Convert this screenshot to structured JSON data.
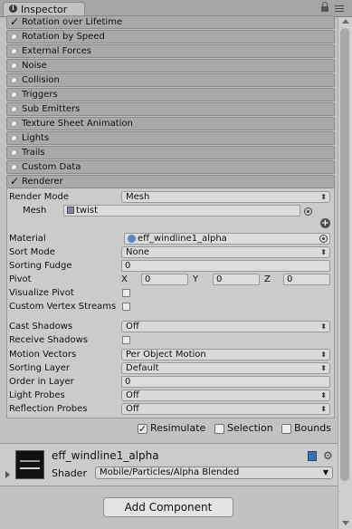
{
  "window": {
    "tab_label": "Inspector"
  },
  "modules": [
    {
      "label": "Rotation over Lifetime",
      "enabled": true
    },
    {
      "label": "Rotation by Speed",
      "enabled": false
    },
    {
      "label": "External Forces",
      "enabled": false
    },
    {
      "label": "Noise",
      "enabled": false
    },
    {
      "label": "Collision",
      "enabled": false
    },
    {
      "label": "Triggers",
      "enabled": false
    },
    {
      "label": "Sub Emitters",
      "enabled": false
    },
    {
      "label": "Texture Sheet Animation",
      "enabled": false
    },
    {
      "label": "Lights",
      "enabled": false
    },
    {
      "label": "Trails",
      "enabled": false
    },
    {
      "label": "Custom Data",
      "enabled": false
    },
    {
      "label": "Renderer",
      "enabled": true
    }
  ],
  "renderer": {
    "render_mode": {
      "label": "Render Mode",
      "value": "Mesh"
    },
    "mesh": {
      "label": "Mesh",
      "value": "twist"
    },
    "material": {
      "label": "Material",
      "value": "eff_windline1_alpha"
    },
    "sort_mode": {
      "label": "Sort Mode",
      "value": "None"
    },
    "sorting_fudge": {
      "label": "Sorting Fudge",
      "value": "0"
    },
    "pivot": {
      "label": "Pivot",
      "x_label": "X",
      "x": "0",
      "y_label": "Y",
      "y": "0",
      "z_label": "Z",
      "z": "0"
    },
    "visualize_pivot": {
      "label": "Visualize Pivot",
      "checked": false
    },
    "custom_vertex_streams": {
      "label": "Custom Vertex Streams",
      "checked": false
    },
    "cast_shadows": {
      "label": "Cast Shadows",
      "value": "Off"
    },
    "receive_shadows": {
      "label": "Receive Shadows",
      "checked": false
    },
    "motion_vectors": {
      "label": "Motion Vectors",
      "value": "Per Object Motion"
    },
    "sorting_layer": {
      "label": "Sorting Layer",
      "value": "Default"
    },
    "order_in_layer": {
      "label": "Order in Layer",
      "value": "0"
    },
    "light_probes": {
      "label": "Light Probes",
      "value": "Off"
    },
    "reflection_probes": {
      "label": "Reflection Probes",
      "value": "Off"
    }
  },
  "toggles": {
    "resimulate": {
      "label": "Resimulate",
      "checked": true
    },
    "selection": {
      "label": "Selection",
      "checked": false
    },
    "bounds": {
      "label": "Bounds",
      "checked": false
    }
  },
  "material_header": {
    "name": "eff_windline1_alpha",
    "shader_label": "Shader",
    "shader_value": "Mobile/Particles/Alpha Blended"
  },
  "add_component_label": "Add Component"
}
